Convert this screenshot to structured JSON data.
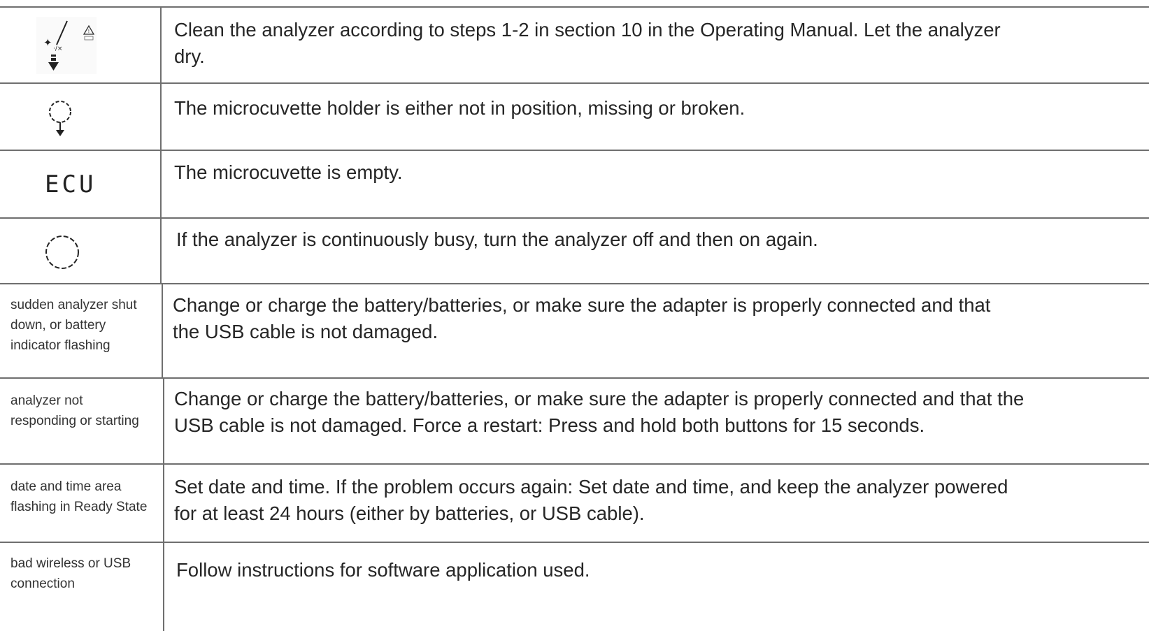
{
  "rows": [
    {
      "icon": "clean-analyzer-icon",
      "label": "",
      "description_lines": [
        "Clean the analyzer according to steps 1-2 in section 10 in the Operating Manual. Let the analyzer",
        "dry."
      ]
    },
    {
      "icon": "microcuvette-holder-icon",
      "label": "",
      "description_lines": [
        "The microcuvette holder is either not in position, missing or broken."
      ]
    },
    {
      "icon": "lcd-ecu-code",
      "icon_text": "ECU",
      "label": "",
      "description_lines": [
        "The microcuvette is empty."
      ]
    },
    {
      "icon": "busy-circle-icon",
      "label": "",
      "description_lines": [
        "If the analyzer is continuously busy, turn the analyzer off and then on again."
      ]
    },
    {
      "icon": "",
      "label_lines": [
        "sudden analyzer shut",
        "down, or battery",
        "indicator flashing"
      ],
      "description_lines": [
        "Change or charge the battery/batteries, or make sure the adapter is properly connected and that",
        "the USB cable is not damaged."
      ]
    },
    {
      "icon": "",
      "label_lines": [
        "analyzer not",
        "responding or starting"
      ],
      "description_lines": [
        "Change or charge the battery/batteries, or make sure the adapter is properly connected and that the",
        "USB cable is not damaged. Force a restart: Press and hold both buttons for 15 seconds."
      ]
    },
    {
      "icon": "",
      "label_lines": [
        "date and time area",
        "flashing in Ready State"
      ],
      "description_lines": [
        "Set date and time. If the problem occurs again: Set date and time, and keep the analyzer powered",
        "for at least 24 hours (either by batteries, or USB cable)."
      ]
    },
    {
      "icon": "",
      "label_lines": [
        "bad wireless or USB",
        "connection"
      ],
      "description_lines": [
        "Follow instructions for software application used."
      ]
    }
  ]
}
